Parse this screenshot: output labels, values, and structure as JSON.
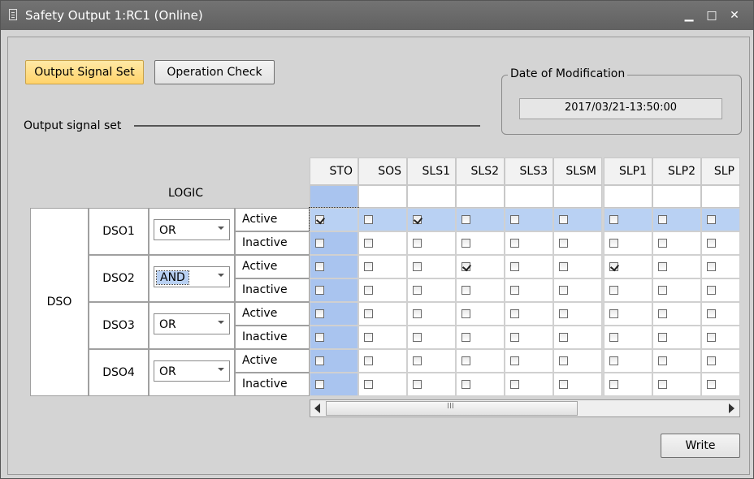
{
  "window": {
    "title": "Safety Output 1:RC1 (Online)",
    "min_icon": "minimize-icon",
    "max_icon": "maximize-icon",
    "close_icon": "close-icon"
  },
  "buttons": {
    "output_signal_set": "Output Signal Set",
    "operation_check": "Operation Check",
    "write": "Write"
  },
  "date_group": {
    "label": "Date of Modification",
    "value": "2017/03/21-13:50:00"
  },
  "section_label": "Output signal set",
  "table": {
    "logic_header": "LOGIC",
    "dso_group_label": "DSO",
    "columns": [
      "STO",
      "SOS",
      "SLS1",
      "SLS2",
      "SLS3",
      "SLSM",
      "SLP1",
      "SLP2",
      "SLP"
    ],
    "rows": [
      {
        "name": "DSO1",
        "logic": "OR",
        "states": [
          {
            "label": "Active",
            "checks": [
              true,
              false,
              true,
              false,
              false,
              false,
              false,
              false,
              false
            ]
          },
          {
            "label": "Inactive",
            "checks": [
              false,
              false,
              false,
              false,
              false,
              false,
              false,
              false,
              false
            ]
          }
        ]
      },
      {
        "name": "DSO2",
        "logic": "AND",
        "states": [
          {
            "label": "Active",
            "checks": [
              false,
              false,
              false,
              true,
              false,
              false,
              true,
              false,
              false
            ]
          },
          {
            "label": "Inactive",
            "checks": [
              false,
              false,
              false,
              false,
              false,
              false,
              false,
              false,
              false
            ]
          }
        ]
      },
      {
        "name": "DSO3",
        "logic": "OR",
        "states": [
          {
            "label": "Active",
            "checks": [
              false,
              false,
              false,
              false,
              false,
              false,
              false,
              false,
              false
            ]
          },
          {
            "label": "Inactive",
            "checks": [
              false,
              false,
              false,
              false,
              false,
              false,
              false,
              false,
              false
            ]
          }
        ]
      },
      {
        "name": "DSO4",
        "logic": "OR",
        "states": [
          {
            "label": "Active",
            "checks": [
              false,
              false,
              false,
              false,
              false,
              false,
              false,
              false,
              false
            ]
          },
          {
            "label": "Inactive",
            "checks": [
              false,
              false,
              false,
              false,
              false,
              false,
              false,
              false,
              false
            ]
          }
        ]
      }
    ]
  },
  "scrollbar": {
    "left_icon": "scroll-left-icon",
    "right_icon": "scroll-right-icon",
    "thumb_grip": "III"
  },
  "colors": {
    "titlebar": "#666666",
    "active_button": "#ffd36a",
    "selected_row": "#b9d1f3",
    "sto_column": "#a9c4ef"
  }
}
